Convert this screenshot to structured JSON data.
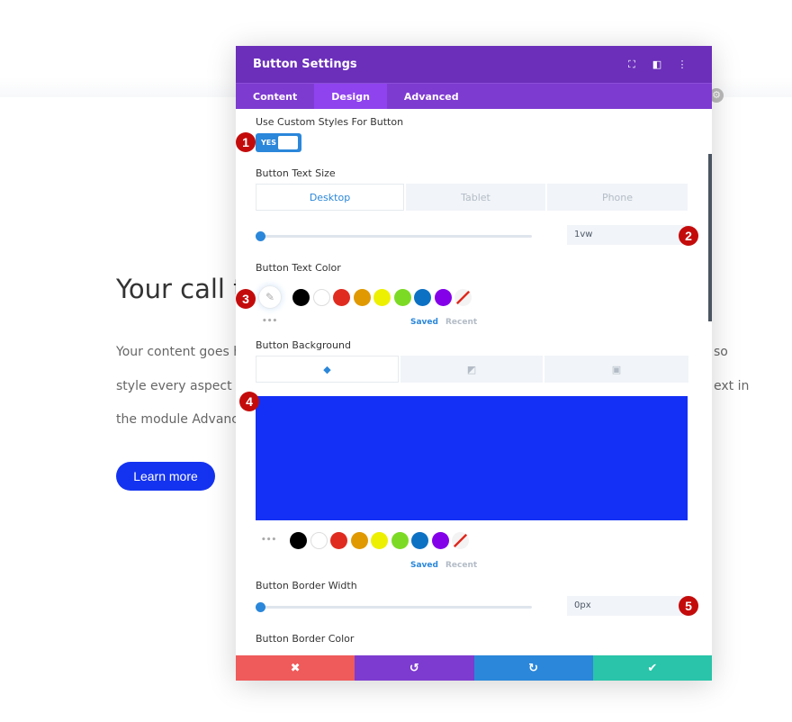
{
  "page": {
    "heading": "Your call t",
    "para_left": [
      "Your content goes h",
      "style every aspect of",
      "the module Advance"
    ],
    "para_right": [
      "so",
      "ext in"
    ],
    "button": "Learn more"
  },
  "modal": {
    "title": "Button Settings",
    "header_icons": [
      "expand-icon",
      "split-view-icon",
      "more-icon"
    ],
    "tabs": [
      {
        "label": "Content"
      },
      {
        "label": "Design",
        "active": true
      },
      {
        "label": "Advanced"
      }
    ],
    "custom_styles": {
      "label": "Use Custom Styles For Button",
      "value": "YES"
    },
    "text_size": {
      "label": "Button Text Size",
      "devices": [
        "Desktop",
        "Tablet",
        "Phone"
      ],
      "value": "1vw"
    },
    "text_color": {
      "label": "Button Text Color",
      "saved": "Saved",
      "recent": "Recent"
    },
    "background": {
      "label": "Button Background",
      "color": "#1430f6",
      "saved": "Saved",
      "recent": "Recent"
    },
    "border_width": {
      "label": "Button Border Width",
      "value": "0px"
    },
    "border_color": {
      "label": "Button Border Color"
    },
    "swatches": [
      "#000000",
      "#ffffff",
      "#e02b20",
      "#e09900",
      "#edf000",
      "#7cda24",
      "#0c71c3",
      "#8300e9"
    ],
    "footer": [
      {
        "name": "cancel",
        "icon": "✖",
        "color": "#ef5a5a"
      },
      {
        "name": "undo",
        "icon": "↺",
        "color": "#7d3bcf"
      },
      {
        "name": "redo",
        "icon": "↻",
        "color": "#2b87da"
      },
      {
        "name": "save",
        "icon": "✔",
        "color": "#29c4a9"
      }
    ]
  },
  "badges": [
    "1",
    "2",
    "3",
    "4",
    "5"
  ]
}
